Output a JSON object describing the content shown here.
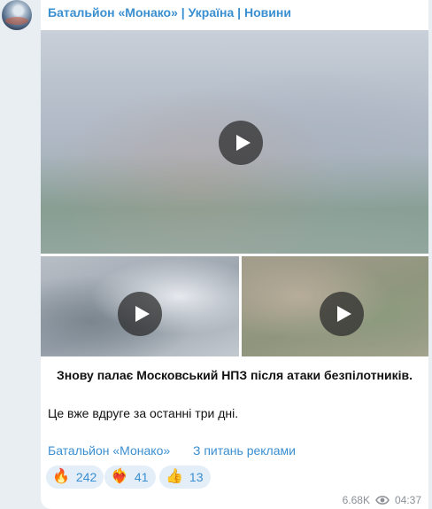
{
  "channel": {
    "name": "Батальйон «Монако» | Україна | Новини",
    "avatar_icon": "channel-avatar"
  },
  "media": [
    {
      "kind": "video",
      "icon": "play-icon"
    },
    {
      "kind": "video",
      "icon": "play-icon"
    },
    {
      "kind": "video",
      "icon": "play-icon"
    }
  ],
  "message": {
    "headline": "Знову палає Московський НПЗ після атаки безпілотників.",
    "body": "Це вже вдруге за останні три дні."
  },
  "links": {
    "channel": "Батальйон «Монако»",
    "ads": "З питань реклами"
  },
  "reactions": [
    {
      "emoji": "🔥",
      "icon": "fire-icon",
      "count": "242"
    },
    {
      "emoji": "❤️‍🔥",
      "icon": "heart-on-fire-icon",
      "count": "41"
    },
    {
      "emoji": "👍",
      "icon": "thumbs-up-icon",
      "count": "13"
    }
  ],
  "meta": {
    "views": "6.68K",
    "views_icon": "eye-icon",
    "time": "04:37"
  },
  "colors": {
    "accent": "#3a8fd0",
    "reaction_bg": "#e3eef8",
    "chat_bg": "#e8eef2"
  }
}
